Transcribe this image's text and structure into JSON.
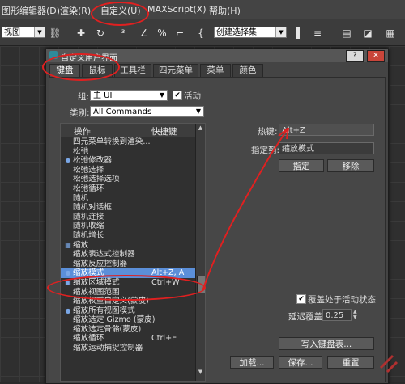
{
  "menubar": {
    "items": [
      "图形编辑器(D)",
      "渲染(R)",
      "自定义(U)",
      "MAXScript(X)",
      "帮助(H)"
    ]
  },
  "toolbar": {
    "viewport_select": "视图",
    "selection_set": "创建选择集",
    "icons": [
      "link-icon",
      "move-icon",
      "rotate-icon",
      "snap-3-icon",
      "percent-snap-icon",
      "spinner-snap-icon",
      "named-selection-icon",
      "mirror-icon",
      "align-icon",
      "layer-icon",
      "curve-editor-icon",
      "schematic-icon"
    ]
  },
  "dialog": {
    "title": "自定义用户界面",
    "help_btn": "?",
    "close_btn": "✕",
    "tabs": [
      "键盘",
      "鼠标",
      "工具栏",
      "四元菜单",
      "菜单",
      "颜色"
    ],
    "active_tab": 0,
    "group_label": "组:",
    "group_value": "主 UI",
    "active_checkbox_label": "活动",
    "category_label": "类别:",
    "category_value": "All Commands",
    "list": {
      "col_action": "操作",
      "col_shortcut": "快捷键",
      "rows": [
        {
          "icon": "",
          "action": "四元菜单转换到渲染...",
          "shortcut": ""
        },
        {
          "icon": "",
          "action": "松弛",
          "shortcut": ""
        },
        {
          "icon": "●",
          "action": "松弛修改器",
          "shortcut": ""
        },
        {
          "icon": "",
          "action": "松弛选择",
          "shortcut": ""
        },
        {
          "icon": "",
          "action": "松弛选择选项",
          "shortcut": ""
        },
        {
          "icon": "",
          "action": "松弛循环",
          "shortcut": ""
        },
        {
          "icon": "",
          "action": "随机",
          "shortcut": ""
        },
        {
          "icon": "",
          "action": "随机对话框",
          "shortcut": ""
        },
        {
          "icon": "",
          "action": "随机连接",
          "shortcut": ""
        },
        {
          "icon": "",
          "action": "随机收缩",
          "shortcut": ""
        },
        {
          "icon": "",
          "action": "随机增长",
          "shortcut": ""
        },
        {
          "icon": "▦",
          "action": "缩放",
          "shortcut": ""
        },
        {
          "icon": "",
          "action": "缩放表达式控制器",
          "shortcut": ""
        },
        {
          "icon": "",
          "action": "缩放反应控制器",
          "shortcut": ""
        },
        {
          "icon": "●",
          "action": "缩放模式",
          "shortcut": "Alt+Z, A"
        },
        {
          "icon": "▣",
          "action": "缩放区域模式",
          "shortcut": "Ctrl+W"
        },
        {
          "icon": "",
          "action": "缩放视图范围",
          "shortcut": ""
        },
        {
          "icon": "",
          "action": "缩放权重自定义(蒙皮)",
          "shortcut": ""
        },
        {
          "icon": "●",
          "action": "缩放所有视图模式",
          "shortcut": ""
        },
        {
          "icon": "",
          "action": "缩放选定 Gizmo (蒙皮)",
          "shortcut": ""
        },
        {
          "icon": "",
          "action": "缩放选定骨骼(蒙皮)",
          "shortcut": ""
        },
        {
          "icon": "",
          "action": "缩放循环",
          "shortcut": "Ctrl+E"
        },
        {
          "icon": "",
          "action": "缩放运动捕捉控制器",
          "shortcut": ""
        }
      ],
      "selected_index": 14
    },
    "hotkey_label": "热键:",
    "hotkey_value": "Alt+Z",
    "assigned_label": "指定到:",
    "assigned_value": "缩放模式",
    "assign_btn": "指定",
    "remove_btn": "移除",
    "override_label": "覆盖处于活动状态",
    "delay_label": "延迟覆盖:",
    "delay_value": "0.25",
    "write_btn": "写入键盘表...",
    "load_btn": "加载...",
    "save_btn": "保存...",
    "reset_btn": "重置"
  },
  "colors": {
    "selection": "#5b8fd9",
    "annotation": "#e02020"
  }
}
